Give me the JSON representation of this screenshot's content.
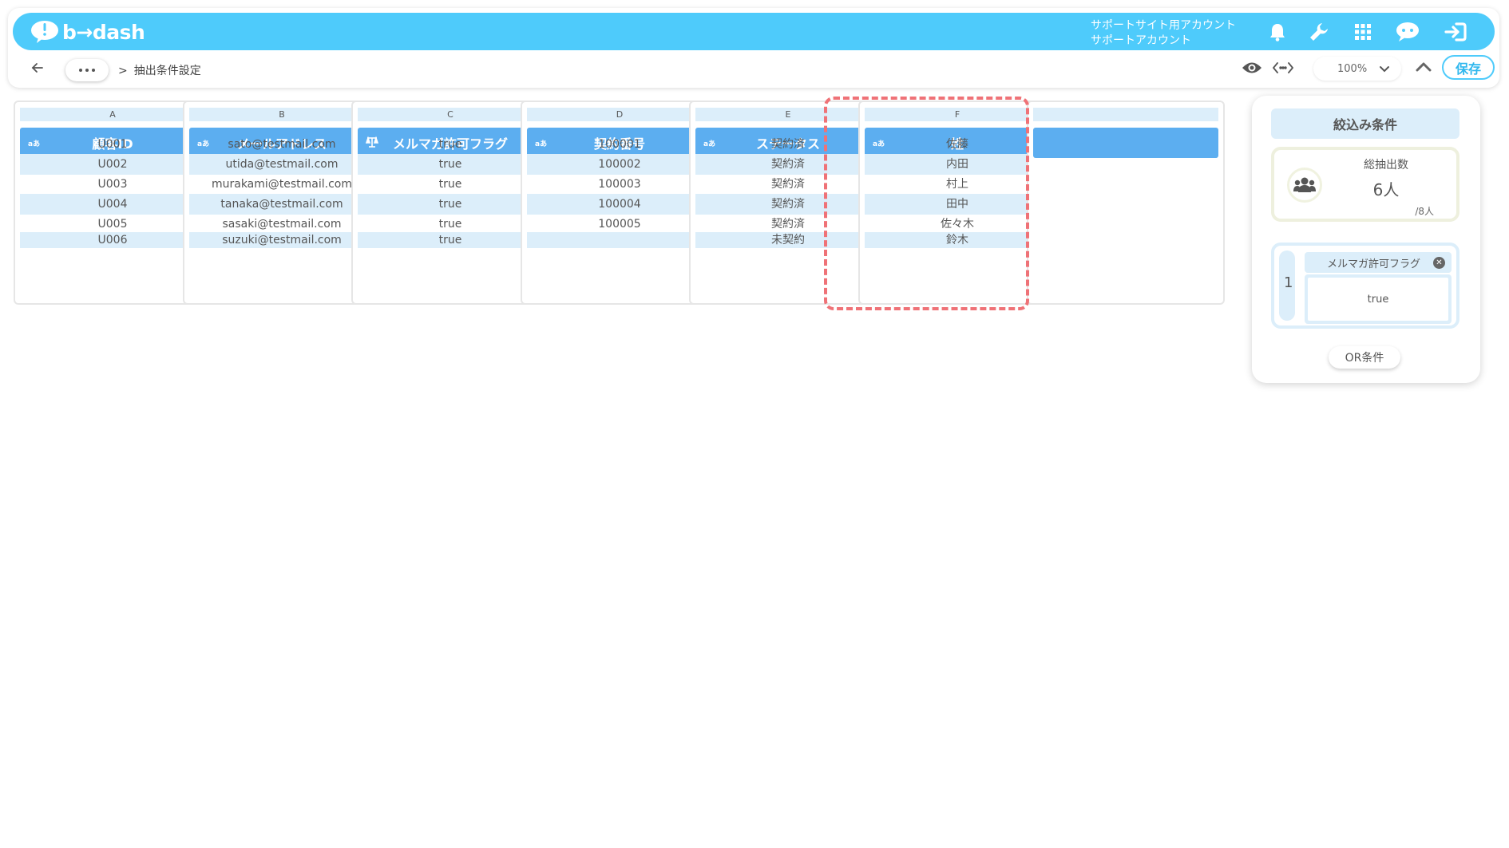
{
  "app": {
    "logo_text": "b→dash",
    "account_line1": "サポートサイト用アカウント",
    "account_line2": "サポートアカウント"
  },
  "header_icons": [
    "bell-icon",
    "wrench-icon",
    "grid-icon",
    "chat-icon",
    "logout-icon"
  ],
  "breadcrumb": {
    "separator": ">",
    "current": "抽出条件設定"
  },
  "toolbar": {
    "zoom": "100%",
    "save_label": "保存"
  },
  "columns": [
    {
      "letter": "A",
      "type": "あ",
      "header": "顧客ID",
      "cells": [
        "U001",
        "U002",
        "U003",
        "U004",
        "U005",
        "U006"
      ]
    },
    {
      "letter": "B",
      "type": "あ",
      "header": "メールアドレス",
      "cells": [
        "sato@testmail.com",
        "utida@testmail.com",
        "murakami@testmail.com",
        "tanaka@testmail.com",
        "sasaki@testmail.com",
        "suzuki@testmail.com"
      ]
    },
    {
      "letter": "C",
      "type": "flag",
      "header": "メルマガ許可フラグ",
      "cells": [
        "true",
        "true",
        "true",
        "true",
        "true",
        "true"
      ]
    },
    {
      "letter": "D",
      "type": "あ",
      "header": "契約番号",
      "cells": [
        "100001",
        "100002",
        "100003",
        "100004",
        "100005",
        ""
      ]
    },
    {
      "letter": "E",
      "type": "あ",
      "header": "ステータス",
      "cells": [
        "契約済",
        "契約済",
        "契約済",
        "契約済",
        "契約済",
        "未契約"
      ]
    },
    {
      "letter": "F",
      "type": "あ",
      "header": "姓",
      "cells": [
        "佐藤",
        "内田",
        "村上",
        "田中",
        "佐々木",
        "鈴木"
      ]
    }
  ],
  "panel": {
    "title": "絞込み条件",
    "count_label": "総抽出数",
    "count_value": "6人",
    "count_total": "/8人",
    "condition_number": "1",
    "condition_field": "メルマガ許可フラグ",
    "condition_value": "true",
    "or_button": "OR条件"
  },
  "colors": {
    "brand": "#4ecbfb",
    "column_header": "#5caef0",
    "stripe": "#dceefa",
    "highlight": "#ef7277"
  }
}
